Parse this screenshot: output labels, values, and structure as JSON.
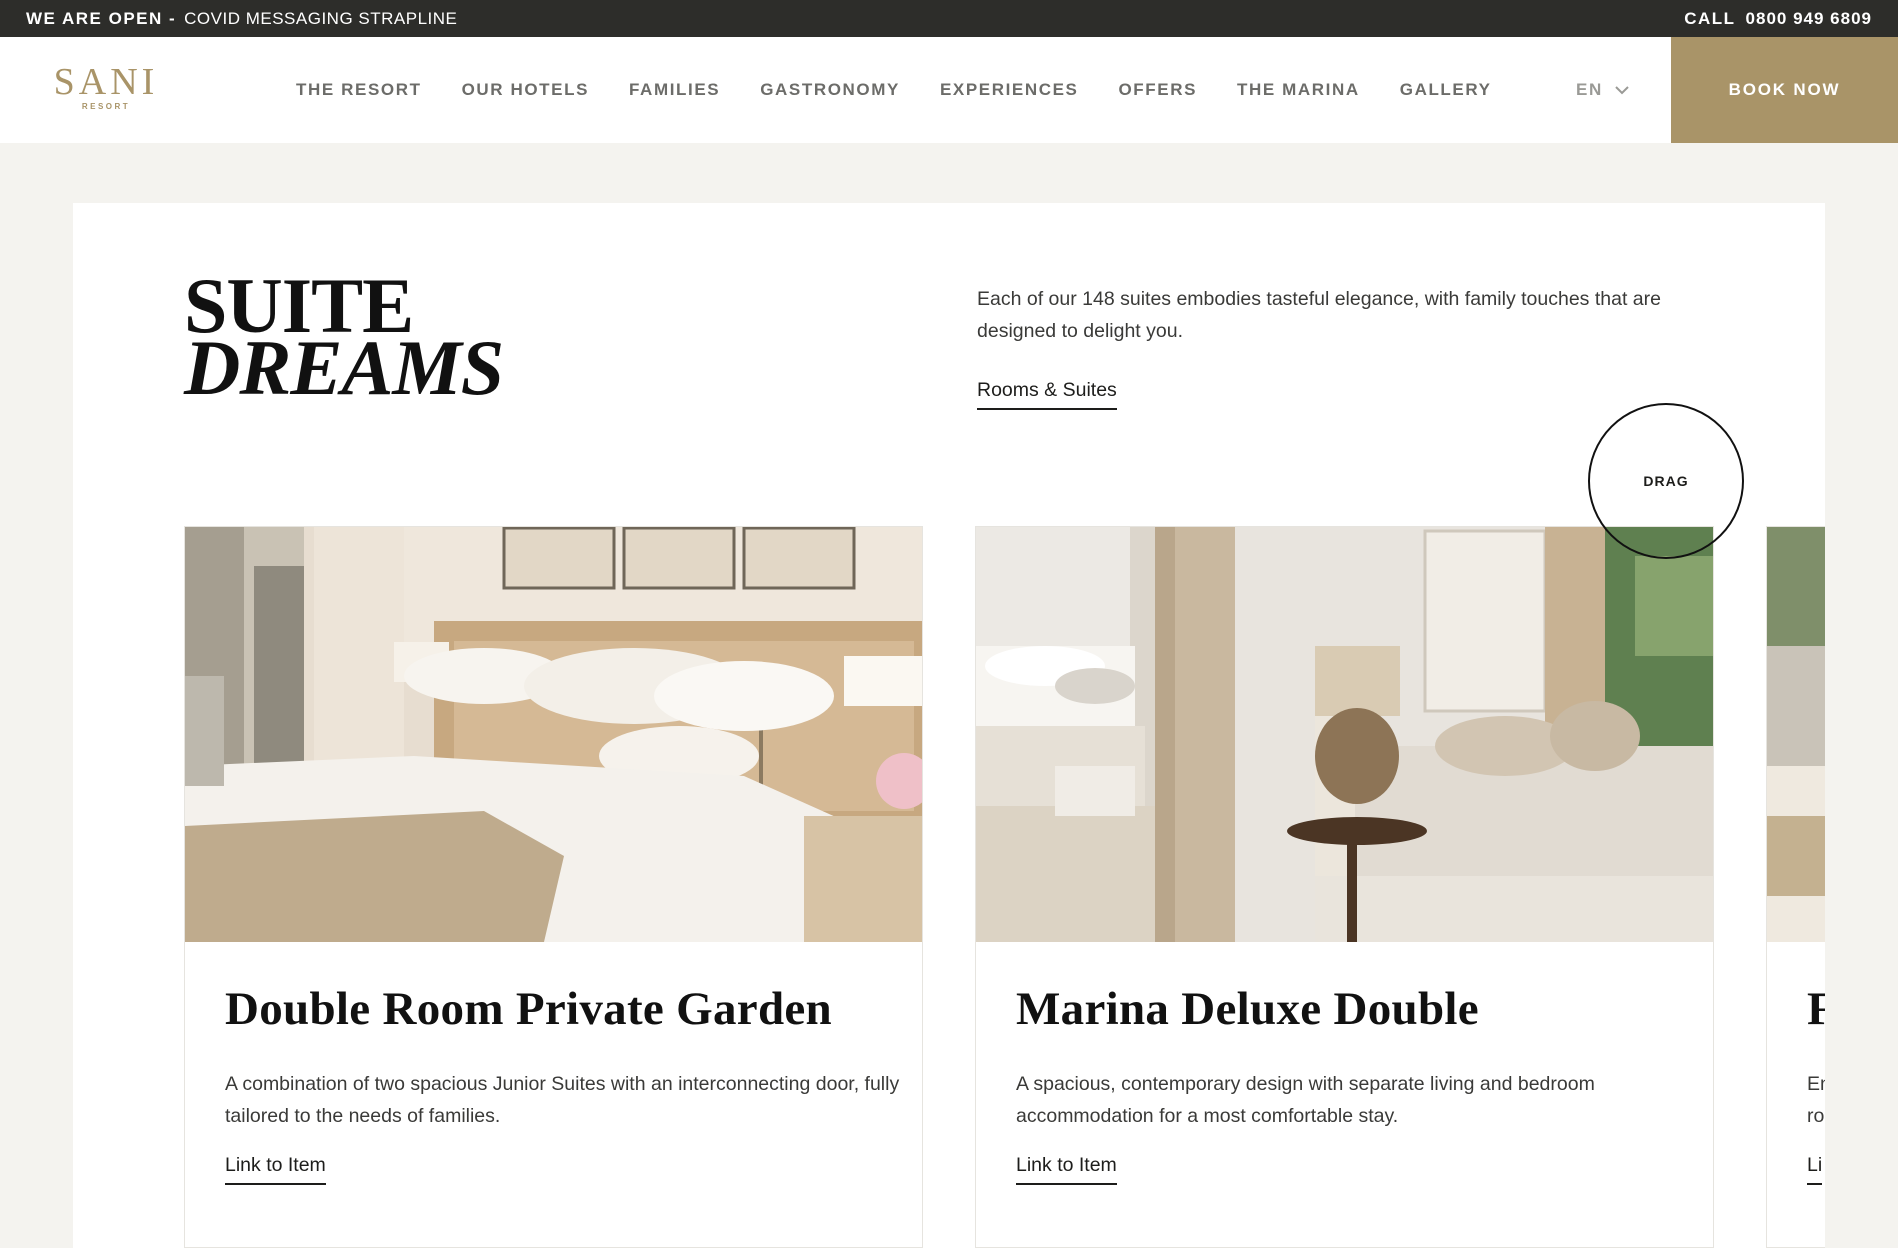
{
  "strapline": {
    "open_label": "WE ARE OPEN -",
    "message": "COVID MESSAGING STRAPLINE",
    "call_label": "CALL",
    "phone": "0800 949 6809"
  },
  "header": {
    "logo_name": "SANI",
    "logo_sub": "RESORT",
    "nav": [
      "THE RESORT",
      "OUR HOTELS",
      "FAMILIES",
      "GASTRONOMY",
      "EXPERIENCES",
      "OFFERS",
      "THE MARINA",
      "GALLERY"
    ],
    "language": "EN",
    "book_label": "BOOK NOW"
  },
  "section": {
    "title_line1": "SUITE",
    "title_line2": "DREAMS",
    "intro": "Each of our 148 suites embodies tasteful elegance, with family touches that are designed to delight you.",
    "link_label": "Rooms & Suites",
    "drag_label": "DRAG"
  },
  "cards": [
    {
      "title": "Double Room Private Garden",
      "description": "A combination of two spacious Junior Suites with an interconnecting door, fully tailored to the needs of families.",
      "link_label": "Link to Item"
    },
    {
      "title": "Marina Deluxe Double",
      "description": "A spacious, contemporary design with separate living and bedroom accommodation for a most comfortable stay.",
      "link_label": "Link to Item"
    },
    {
      "title": "F",
      "description": "En ro",
      "link_label": "Li"
    }
  ],
  "colors": {
    "brand_gold": "#a99468",
    "strap_bg": "#2d2d2a",
    "page_bg": "#f4f3ef"
  }
}
